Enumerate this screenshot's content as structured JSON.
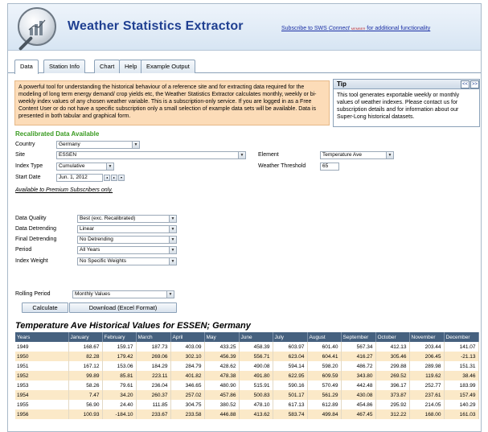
{
  "header": {
    "title": "Weather Statistics Extractor",
    "subscribe": {
      "prefix": "Subscribe to SWS ",
      "connect": "Connect",
      "suffix": " for additional functionality",
      "badge": "MEMBER"
    }
  },
  "tabs": [
    "Data",
    "Station Info",
    "Chart",
    "Help",
    "Example Output"
  ],
  "intro": "A powerful tool for understanding the historical behaviour of a reference site and for extracting data required for the modeling of long term energy demand/ crop yields etc, the Weather Statistics Extractor calculates monthly, weekly or bi-weekly index values of any chosen weather variable. This is a subscription-only service. If you are logged in as a Free Content User or do not have a specific subscription only a small selection of example data sets will be available. Data is presented in both tabular and graphical form.",
  "tip": {
    "title": "Tip",
    "prev": "<<",
    "next": ">>",
    "body": "This tool generates exportable weekly or monthly values of weather indexes. Please contact us for subscription details and for information about our Super-Long historical datasets."
  },
  "form": {
    "heading": "Recalibrated Data Available",
    "country_label": "Country",
    "country_value": "Germany",
    "site_label": "Site",
    "site_value": "ESSEN",
    "index_type_label": "Index Type",
    "index_type_value": "Cumulative",
    "start_date_label": "Start Date",
    "start_date_value": "Jun. 1, 2012",
    "element_label": "Element",
    "element_value": "Temperature Ave",
    "threshold_label": "Weather Threshold",
    "threshold_value": "65",
    "premium_note": "Available to Premium Subscribers only.",
    "data_quality_label": "Data Quality",
    "data_quality_value": "Best (exc. Recalibrated)",
    "data_detrending_label": "Data Detrending",
    "data_detrending_value": "Linear",
    "final_detrending_label": "Final Detrending",
    "final_detrending_value": "No Detrending",
    "period_label": "Period",
    "period_value": "All Years",
    "index_weight_label": "Index Weight",
    "index_weight_value": "No Specific Weights",
    "rolling_period_label": "Rolling Period",
    "rolling_period_value": "Monthly Values",
    "calculate_label": "Calculate",
    "download_label": "Download (Excel Format)"
  },
  "table": {
    "title": "Temperature Ave Historical Values for ESSEN; Germany",
    "headers": [
      "Years",
      "January",
      "February",
      "March",
      "April",
      "May",
      "June",
      "July",
      "August",
      "September",
      "October",
      "November",
      "December"
    ],
    "rows": [
      [
        "1949",
        "168.67",
        "159.17",
        "187.73",
        "403.09",
        "433.25",
        "458.39",
        "603.97",
        "601.40",
        "567.34",
        "412.13",
        "203.44",
        "141.07"
      ],
      [
        "1950",
        "82.28",
        "179.42",
        "269.06",
        "302.10",
        "456.39",
        "556.71",
        "623.04",
        "604.41",
        "416.27",
        "305.46",
        "206.45",
        "-21.13"
      ],
      [
        "1951",
        "167.12",
        "153.06",
        "184.29",
        "284.79",
        "428.62",
        "490.08",
        "594.14",
        "598.20",
        "486.72",
        "299.88",
        "289.98",
        "151.31"
      ],
      [
        "1952",
        "99.89",
        "85.81",
        "223.11",
        "401.82",
        "478.38",
        "491.80",
        "622.95",
        "609.59",
        "343.80",
        "269.52",
        "119.62",
        "38.46"
      ],
      [
        "1953",
        "58.26",
        "79.61",
        "236.04",
        "346.65",
        "480.90",
        "515.91",
        "590.16",
        "570.49",
        "442.48",
        "396.17",
        "252.77",
        "183.99"
      ],
      [
        "1954",
        "7.47",
        "34.20",
        "260.37",
        "257.02",
        "457.86",
        "500.83",
        "501.17",
        "561.29",
        "430.08",
        "373.87",
        "237.61",
        "157.49"
      ],
      [
        "1955",
        "56.90",
        "24.40",
        "111.85",
        "304.75",
        "380.52",
        "478.10",
        "617.13",
        "612.89",
        "454.86",
        "295.92",
        "214.05",
        "140.29"
      ],
      [
        "1956",
        "100.93",
        "-184.10",
        "233.67",
        "233.58",
        "446.88",
        "413.62",
        "583.74",
        "499.84",
        "467.45",
        "312.22",
        "168.00",
        "161.03"
      ]
    ]
  }
}
